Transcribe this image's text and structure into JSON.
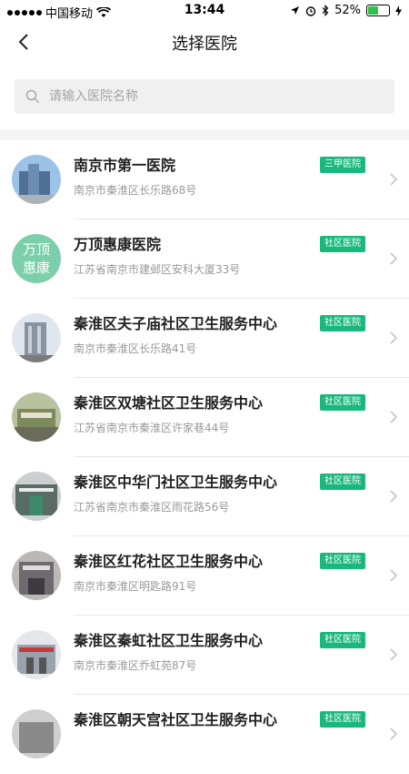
{
  "status_bar": {
    "carrier": "中国移动",
    "time": "13:44",
    "battery_percent": "52%"
  },
  "nav": {
    "title": "选择医院"
  },
  "search": {
    "placeholder": "请输入医院名称"
  },
  "hospitals": [
    {
      "name": "南京市第一医院",
      "address": "南京市秦淮区长乐路68号",
      "badge": "三甲医院",
      "avatar_color": "#5e7fa8"
    },
    {
      "name": "万顶惠康医院",
      "address": "江苏省南京市建邺区安科大厦33号",
      "badge": "社区医院",
      "avatar_text_1": "万顶",
      "avatar_text_2": "惠康",
      "avatar_color": "#7ccfaa"
    },
    {
      "name": "秦淮区夫子庙社区卫生服务中心",
      "address": "南京市秦淮区长乐路41号",
      "badge": "社区医院",
      "avatar_color": "#8a94a0"
    },
    {
      "name": "秦淮区双塘社区卫生服务中心",
      "address": "江苏省南京市秦淮区许家巷44号",
      "badge": "社区医院",
      "avatar_color": "#7d8a5c"
    },
    {
      "name": "秦淮区中华门社区卫生服务中心",
      "address": "江苏省南京市秦淮区雨花路56号",
      "badge": "社区医院",
      "avatar_color": "#5a6b66"
    },
    {
      "name": "秦淮区红花社区卫生服务中心",
      "address": "南京市秦淮区明匙路91号",
      "badge": "社区医院",
      "avatar_color": "#6e6a70"
    },
    {
      "name": "秦淮区秦虹社区卫生服务中心",
      "address": "南京市秦淮区乔虹苑87号",
      "badge": "社区医院",
      "avatar_color": "#9aa3ad"
    },
    {
      "name": "秦淮区朝天宫社区卫生服务中心",
      "address": "",
      "badge": "社区医院",
      "avatar_color": "#8a8a8a"
    }
  ],
  "colors": {
    "badge_green": "#19b97e",
    "search_bg": "#f0f0f0",
    "divider": "#e8e8e8"
  }
}
